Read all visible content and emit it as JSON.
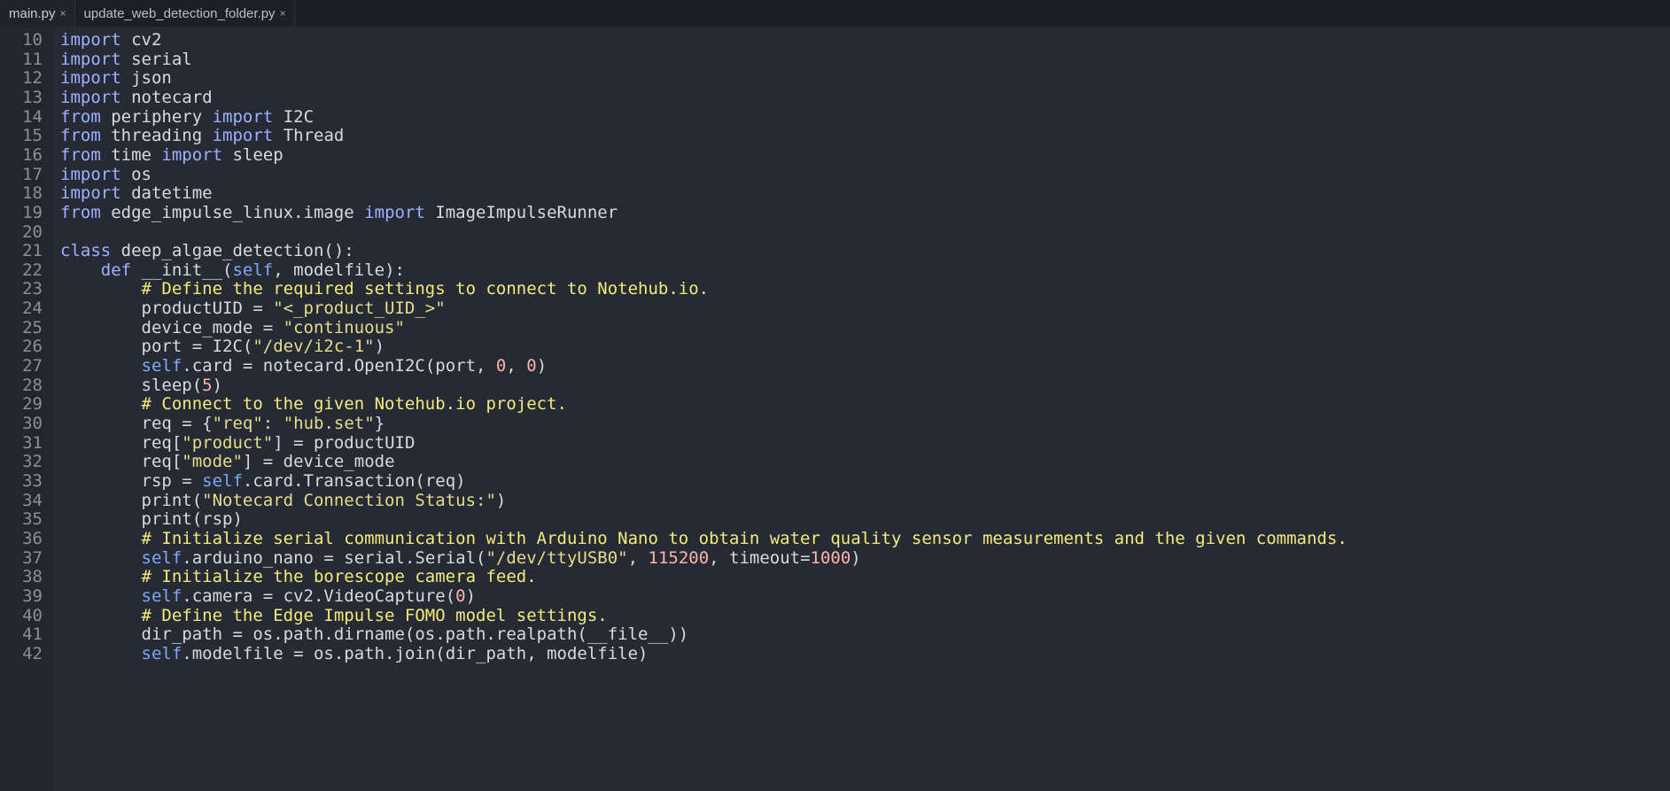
{
  "tabs": [
    {
      "label": "main.py",
      "close": "×",
      "active": true
    },
    {
      "label": "update_web_detection_folder.py",
      "close": "×",
      "active": false
    }
  ],
  "colors": {
    "background": "#262a34",
    "keyword": "#9fb0ff",
    "string": "#e4dd8c",
    "number": "#ffb4a8",
    "self": "#7ea8f5",
    "comment": "#f3eb7a",
    "text": "#d7dae0"
  },
  "lines": [
    {
      "n": "10",
      "tokens": [
        [
          "kw",
          "import"
        ],
        [
          "t",
          " cv2"
        ]
      ]
    },
    {
      "n": "11",
      "tokens": [
        [
          "kw",
          "import"
        ],
        [
          "t",
          " serial"
        ]
      ]
    },
    {
      "n": "12",
      "tokens": [
        [
          "kw",
          "import"
        ],
        [
          "t",
          " json"
        ]
      ]
    },
    {
      "n": "13",
      "tokens": [
        [
          "kw",
          "import"
        ],
        [
          "t",
          " notecard"
        ]
      ]
    },
    {
      "n": "14",
      "tokens": [
        [
          "kw",
          "from"
        ],
        [
          "t",
          " periphery "
        ],
        [
          "kw",
          "import"
        ],
        [
          "t",
          " I2C"
        ]
      ]
    },
    {
      "n": "15",
      "tokens": [
        [
          "kw",
          "from"
        ],
        [
          "t",
          " threading "
        ],
        [
          "kw",
          "import"
        ],
        [
          "t",
          " Thread"
        ]
      ]
    },
    {
      "n": "16",
      "tokens": [
        [
          "kw",
          "from"
        ],
        [
          "t",
          " time "
        ],
        [
          "kw",
          "import"
        ],
        [
          "t",
          " sleep"
        ]
      ]
    },
    {
      "n": "17",
      "tokens": [
        [
          "kw",
          "import"
        ],
        [
          "t",
          " os"
        ]
      ]
    },
    {
      "n": "18",
      "tokens": [
        [
          "kw",
          "import"
        ],
        [
          "t",
          " datetime"
        ]
      ]
    },
    {
      "n": "19",
      "tokens": [
        [
          "kw",
          "from"
        ],
        [
          "t",
          " edge_impulse_linux.image "
        ],
        [
          "kw",
          "import"
        ],
        [
          "t",
          " ImageImpulseRunner"
        ]
      ]
    },
    {
      "n": "20",
      "tokens": []
    },
    {
      "n": "21",
      "tokens": [
        [
          "kw",
          "class"
        ],
        [
          "t",
          " deep_algae_detection():"
        ]
      ]
    },
    {
      "n": "22",
      "tokens": [
        [
          "t",
          "    "
        ],
        [
          "kw",
          "def"
        ],
        [
          "t",
          " __init__("
        ],
        [
          "self",
          "self"
        ],
        [
          "t",
          ", modelfile):"
        ]
      ]
    },
    {
      "n": "23",
      "tokens": [
        [
          "t",
          "        "
        ],
        [
          "cm",
          "# Define the required settings to connect to Notehub.io."
        ]
      ]
    },
    {
      "n": "24",
      "tokens": [
        [
          "t",
          "        productUID = "
        ],
        [
          "str",
          "\"<_product_UID_>\""
        ]
      ]
    },
    {
      "n": "25",
      "tokens": [
        [
          "t",
          "        device_mode = "
        ],
        [
          "str",
          "\"continuous\""
        ]
      ]
    },
    {
      "n": "26",
      "tokens": [
        [
          "t",
          "        port = I2C("
        ],
        [
          "str",
          "\"/dev/i2c-1\""
        ],
        [
          "t",
          ")"
        ]
      ]
    },
    {
      "n": "27",
      "tokens": [
        [
          "t",
          "        "
        ],
        [
          "self",
          "self"
        ],
        [
          "t",
          ".card = notecard.OpenI2C(port, "
        ],
        [
          "num",
          "0"
        ],
        [
          "t",
          ", "
        ],
        [
          "num",
          "0"
        ],
        [
          "t",
          ")"
        ]
      ]
    },
    {
      "n": "28",
      "tokens": [
        [
          "t",
          "        sleep("
        ],
        [
          "num",
          "5"
        ],
        [
          "t",
          ")"
        ]
      ]
    },
    {
      "n": "29",
      "tokens": [
        [
          "t",
          "        "
        ],
        [
          "cm",
          "# Connect to the given Notehub.io project."
        ]
      ]
    },
    {
      "n": "30",
      "tokens": [
        [
          "t",
          "        req = {"
        ],
        [
          "str",
          "\"req\""
        ],
        [
          "t",
          ": "
        ],
        [
          "str",
          "\"hub.set\""
        ],
        [
          "t",
          "}"
        ]
      ]
    },
    {
      "n": "31",
      "tokens": [
        [
          "t",
          "        req["
        ],
        [
          "str",
          "\"product\""
        ],
        [
          "t",
          "] = productUID"
        ]
      ]
    },
    {
      "n": "32",
      "tokens": [
        [
          "t",
          "        req["
        ],
        [
          "str",
          "\"mode\""
        ],
        [
          "t",
          "] = device_mode"
        ]
      ]
    },
    {
      "n": "33",
      "tokens": [
        [
          "t",
          "        rsp = "
        ],
        [
          "self",
          "self"
        ],
        [
          "t",
          ".card.Transaction(req)"
        ]
      ]
    },
    {
      "n": "34",
      "tokens": [
        [
          "t",
          "        print("
        ],
        [
          "str",
          "\"Notecard Connection Status:\""
        ],
        [
          "t",
          ")"
        ]
      ]
    },
    {
      "n": "35",
      "tokens": [
        [
          "t",
          "        print(rsp)"
        ]
      ]
    },
    {
      "n": "36",
      "tokens": [
        [
          "t",
          "        "
        ],
        [
          "cm",
          "# Initialize serial communication with Arduino Nano to obtain water quality sensor measurements and the given commands."
        ]
      ]
    },
    {
      "n": "37",
      "tokens": [
        [
          "t",
          "        "
        ],
        [
          "self",
          "self"
        ],
        [
          "t",
          ".arduino_nano = serial.Serial("
        ],
        [
          "str",
          "\"/dev/ttyUSB0\""
        ],
        [
          "t",
          ", "
        ],
        [
          "num",
          "115200"
        ],
        [
          "t",
          ", timeout="
        ],
        [
          "num",
          "1000"
        ],
        [
          "t",
          ")"
        ]
      ]
    },
    {
      "n": "38",
      "tokens": [
        [
          "t",
          "        "
        ],
        [
          "cm",
          "# Initialize the borescope camera feed."
        ]
      ]
    },
    {
      "n": "39",
      "tokens": [
        [
          "t",
          "        "
        ],
        [
          "self",
          "self"
        ],
        [
          "t",
          ".camera = cv2.VideoCapture("
        ],
        [
          "num",
          "0"
        ],
        [
          "t",
          ")"
        ]
      ]
    },
    {
      "n": "40",
      "tokens": [
        [
          "t",
          "        "
        ],
        [
          "cm",
          "# Define the Edge Impulse FOMO model settings."
        ]
      ]
    },
    {
      "n": "41",
      "tokens": [
        [
          "t",
          "        dir_path = os.path.dirname(os.path.realpath(__file__))"
        ]
      ]
    },
    {
      "n": "42",
      "tokens": [
        [
          "t",
          "        "
        ],
        [
          "self",
          "self"
        ],
        [
          "t",
          ".modelfile = os.path.join(dir_path, modelfile)"
        ]
      ]
    }
  ]
}
